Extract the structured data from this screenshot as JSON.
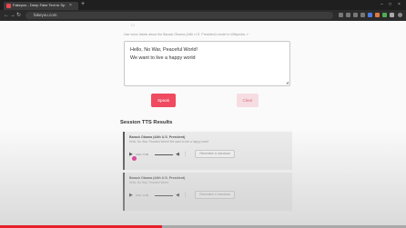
{
  "browser": {
    "tab_title": "Fakeyou - Deep Fake Text to Sp",
    "tab_close": "×",
    "new_tab": "+",
    "url": "fakeyou.com",
    "window_controls": [
      "–",
      "□",
      "×"
    ]
  },
  "page": {
    "hint_text": "Use voice labels about the Barack Obama (44th U.S. President) model to Wikipedia ↗",
    "textarea_value": "Hello, No War, Peaceful World!\nWe want to live a happy world",
    "speak_label": "Speak",
    "clear_label": "Clear",
    "session_title": "Session TTS Results",
    "results": [
      {
        "title": "Barack Obama (44th U.S. President)",
        "text": "Hello, No War, Peaceful World! We want to live a happy world",
        "time": "0:00 / 0:00",
        "button": "Remember & download"
      },
      {
        "title": "Barack Obama (44th U.S. President)",
        "text": "Hello, No War, Peaceful World",
        "time": "0:00 / 0:00",
        "button": "Remember & download"
      }
    ]
  },
  "video_progress": 0.4,
  "colors": {
    "speak": "#ef4a60",
    "clear_bg": "#f6dde1",
    "accent_link": "#6c7fd8",
    "progress": "#e6202a"
  }
}
